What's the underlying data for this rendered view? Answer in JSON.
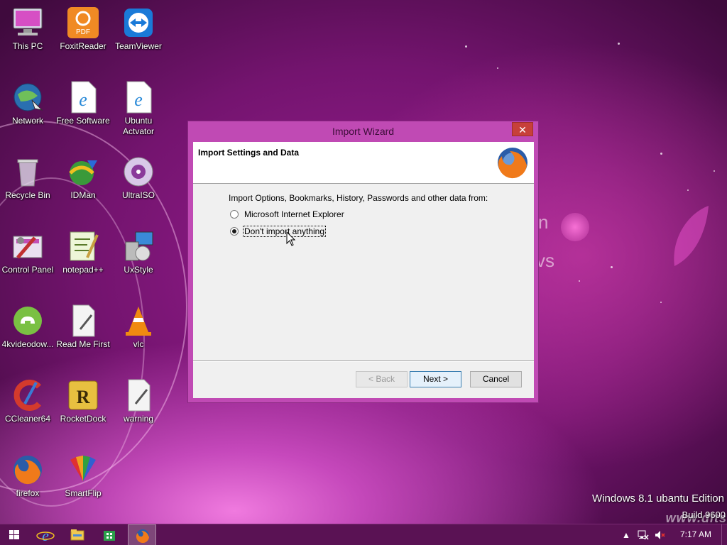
{
  "desktop": {
    "icons": [
      {
        "label": "This PC",
        "icon": "computer-icon"
      },
      {
        "label": "FoxitReader",
        "icon": "foxit-pdf-icon"
      },
      {
        "label": "TeamViewer",
        "icon": "teamviewer-icon"
      },
      {
        "label": "Network",
        "icon": "network-globe-icon"
      },
      {
        "label": "Free Software",
        "icon": "internet-explorer-file-icon"
      },
      {
        "label": "Ubuntu Actvator",
        "icon": "internet-explorer-file-icon"
      },
      {
        "label": "Recycle Bin",
        "icon": "recycle-bin-icon"
      },
      {
        "label": "IDMan",
        "icon": "idm-icon"
      },
      {
        "label": "UltraISO",
        "icon": "disc-icon"
      },
      {
        "label": "Control Panel",
        "icon": "control-panel-icon"
      },
      {
        "label": "notepad++",
        "icon": "notepadpp-icon"
      },
      {
        "label": "UxStyle",
        "icon": "uxstyle-icon"
      },
      {
        "label": "4kvideodow...",
        "icon": "video-downloader-icon"
      },
      {
        "label": "Read Me First",
        "icon": "text-file-icon"
      },
      {
        "label": "vlc",
        "icon": "vlc-cone-icon"
      },
      {
        "label": "CCleaner64",
        "icon": "ccleaner-icon"
      },
      {
        "label": "RocketDock",
        "icon": "rocketdock-icon"
      },
      {
        "label": "warning",
        "icon": "text-file-icon"
      },
      {
        "label": "firefox",
        "icon": "firefox-icon"
      },
      {
        "label": "SmartFlip",
        "icon": "smartflip-icon"
      }
    ],
    "edition_text": "Windows 8.1 ubantu Edition",
    "build_text": "Build 9600",
    "watermark_text": "www.dits"
  },
  "wizard": {
    "title": "Import Wizard",
    "close_symbol": "✕",
    "heading": "Import Settings and Data",
    "logo_icon": "firefox-icon",
    "prompt": "Import Options, Bookmarks, History, Passwords and other data from:",
    "options": [
      {
        "label": "Microsoft Internet Explorer",
        "selected": false
      },
      {
        "label": "Don't import anything",
        "selected": true
      }
    ],
    "buttons": {
      "back": "< Back",
      "next": "Next >",
      "cancel": "Cancel"
    }
  },
  "taskbar": {
    "items": [
      "start-icon",
      "internet-explorer-icon",
      "file-explorer-icon",
      "store-icon",
      "firefox-icon"
    ],
    "active_item": "firefox-icon",
    "tray": {
      "overflow_symbol": "▲",
      "clock": "7:17 AM"
    }
  },
  "colors": {
    "window_frame": "#c04ab4",
    "close_button": "#c7403a",
    "taskbar": "#5a1254",
    "default_button_border": "#3c7fb1"
  }
}
